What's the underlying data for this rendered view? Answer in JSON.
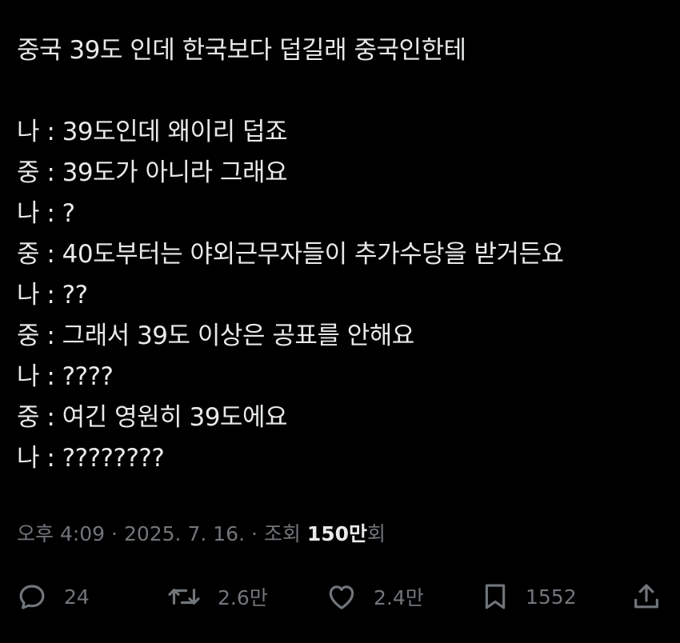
{
  "tweet": {
    "lines": [
      "중국 39도 인데 한국보다 덥길래 중국인한테",
      "",
      "나 : 39도인데 왜이리 덥죠",
      "중 : 39도가 아니라 그래요",
      "나 : ?",
      "중 : 40도부터는 야외근무자들이 추가수당을 받거든요",
      "나 : ??",
      "중 : 그래서 39도 이상은 공표를 안해요",
      "나 : ????",
      "중 : 여긴 영원히 39도에요",
      "나 : ????????"
    ]
  },
  "meta": {
    "time": "오후 4:09",
    "separator": " · ",
    "date": "2025. 7. 16.",
    "views_prefix": "조회 ",
    "views_count": "150만",
    "views_suffix": "회"
  },
  "actions": {
    "reply": {
      "icon": "reply-icon",
      "count": "24"
    },
    "retweet": {
      "icon": "retweet-icon",
      "count": "2.6만"
    },
    "like": {
      "icon": "heart-icon",
      "count": "2.4만"
    },
    "bookmark": {
      "icon": "bookmark-icon",
      "count": "1552"
    },
    "share": {
      "icon": "share-icon"
    }
  },
  "colors": {
    "background": "#000000",
    "text": "#e7e9ea",
    "secondary": "#71767b"
  }
}
